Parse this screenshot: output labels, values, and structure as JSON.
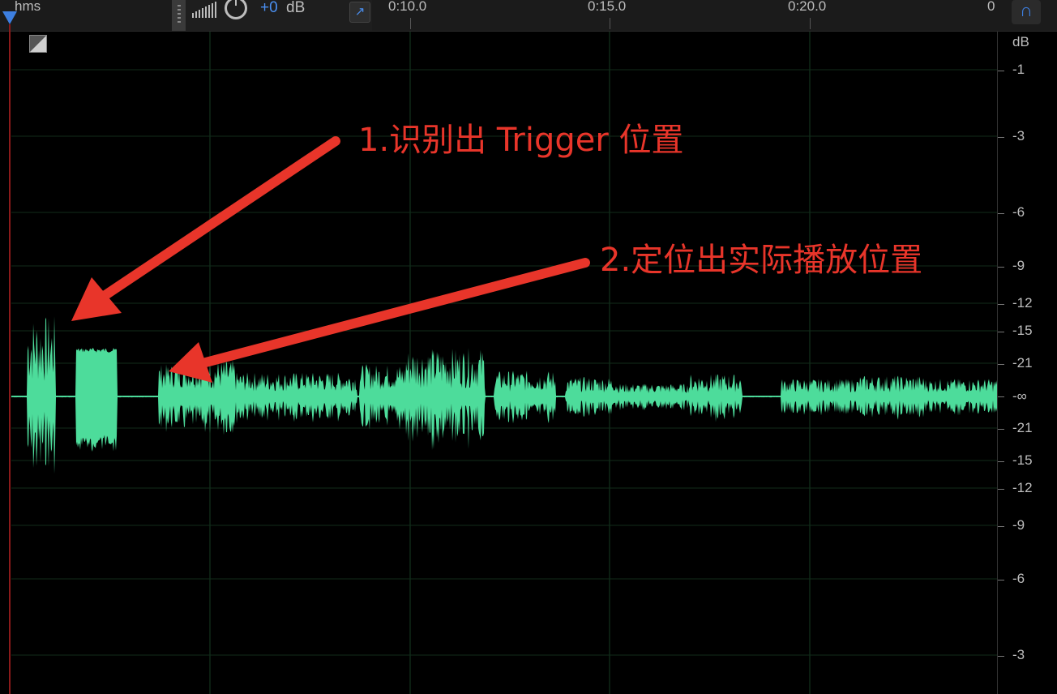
{
  "ruler": {
    "unit": "hms",
    "ticks": [
      "0:10.0",
      "0:15.0",
      "0:20.0",
      "0"
    ]
  },
  "hud": {
    "volume_value": "+0",
    "volume_unit": "dB"
  },
  "db_scale": {
    "labels": [
      "dB",
      "-1",
      "-3",
      "-6",
      "-9",
      "-12",
      "-15",
      "-21",
      "-∞",
      "-21",
      "-15",
      "-12",
      "-9",
      "-6",
      "-3"
    ]
  },
  "annotations": {
    "first": "1.识别出 Trigger 位置",
    "second": "2.定位出实际播放位置"
  },
  "colors": {
    "waveform": "#4ddc9b",
    "annotation": "#e8352a",
    "accent": "#3d7fe0"
  }
}
